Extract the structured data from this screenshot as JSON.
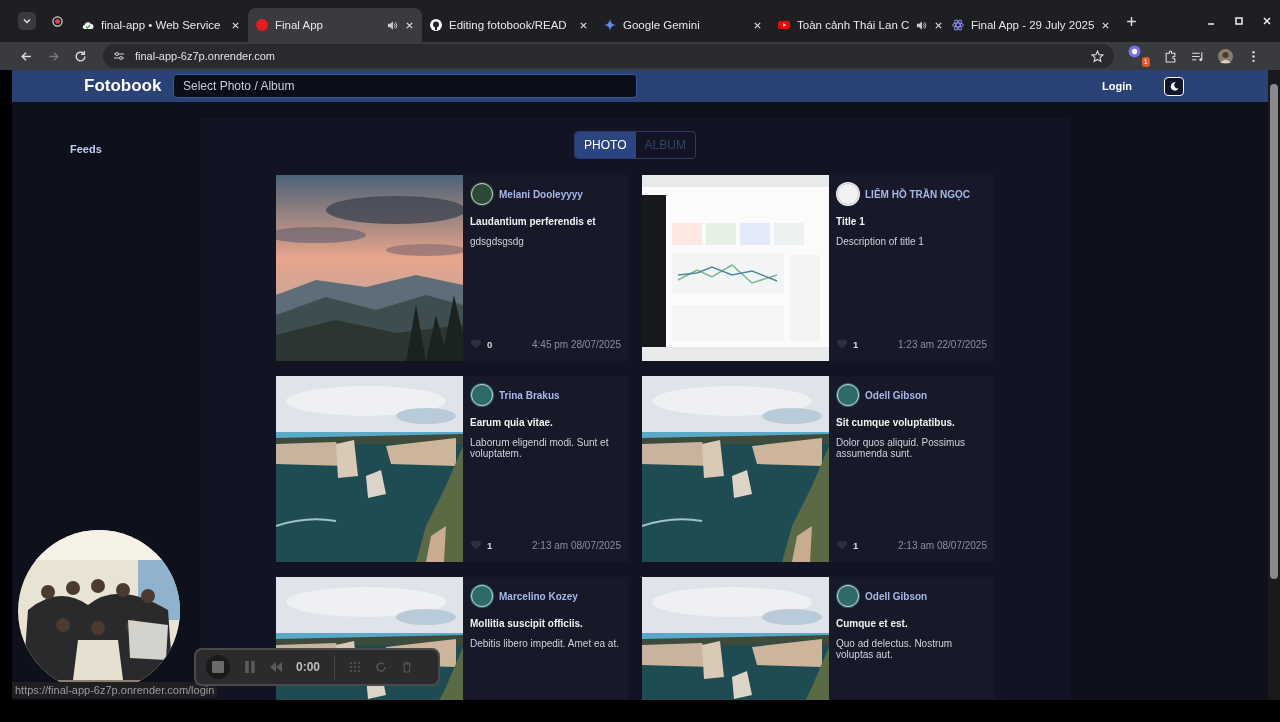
{
  "browser": {
    "tabs": [
      {
        "title": "final-app • Web Service",
        "kind": "render",
        "selected": false,
        "audio": false
      },
      {
        "title": "Final App",
        "kind": "dot",
        "selected": true,
        "audio": true
      },
      {
        "title": "Editing fotobook/READ",
        "kind": "github",
        "selected": false,
        "audio": false
      },
      {
        "title": "Google Gemini",
        "kind": "gemini",
        "selected": false,
        "audio": false
      },
      {
        "title": "Toàn cảnh Thái Lan C",
        "kind": "youtube",
        "selected": false,
        "audio": true
      },
      {
        "title": "Final App - 29 July 2025",
        "kind": "app",
        "selected": false,
        "audio": false
      }
    ],
    "address": "final-app-6z7p.onrender.com",
    "extension_badge": "1",
    "status_url": "https://final-app-6z7p.onrender.com/login"
  },
  "app": {
    "brand": "Fotobook",
    "search": {
      "placeholder": "Select Photo / Album"
    },
    "login": "Login",
    "sidebar": {
      "items": [
        "Feeds"
      ]
    },
    "toggle": [
      {
        "label": "PHOTO",
        "selected": true
      },
      {
        "label": "ALBUM",
        "selected": false
      }
    ],
    "posts": [
      {
        "author": "Melani Dooleyyyy",
        "title": "Laudantium perferendis et",
        "description": "gdsgdsgsdg",
        "likes": "0",
        "time": "4:45 pm 28/07/2025"
      },
      {
        "author": "LIÊM HỒ TRẦN NGỌC",
        "title": "Title 1",
        "description": "Description of title 1",
        "likes": "1",
        "time": "1:23 am 22/07/2025"
      },
      {
        "author": "Trina Brakus",
        "title": "Earum quia vitae.",
        "description": "Laborum eligendi modi. Sunt et voluptatem.",
        "likes": "1",
        "time": "2:13 am 08/07/2025"
      },
      {
        "author": "Odell Gibson",
        "title": "Sit cumque voluptatibus.",
        "description": "Dolor quos aliquid. Possimus assumenda sunt.",
        "likes": "1",
        "time": "2:13 am 08/07/2025"
      },
      {
        "author": "Marcelino Kozey",
        "title": "Mollitia suscipit officiis.",
        "description": "Debitis libero impedit. Amet ea at."
      },
      {
        "author": "Odell Gibson",
        "title": "Cumque et est.",
        "description": "Quo ad delectus. Nostrum voluptas aut."
      }
    ]
  },
  "recorder": {
    "time": "0:00"
  }
}
